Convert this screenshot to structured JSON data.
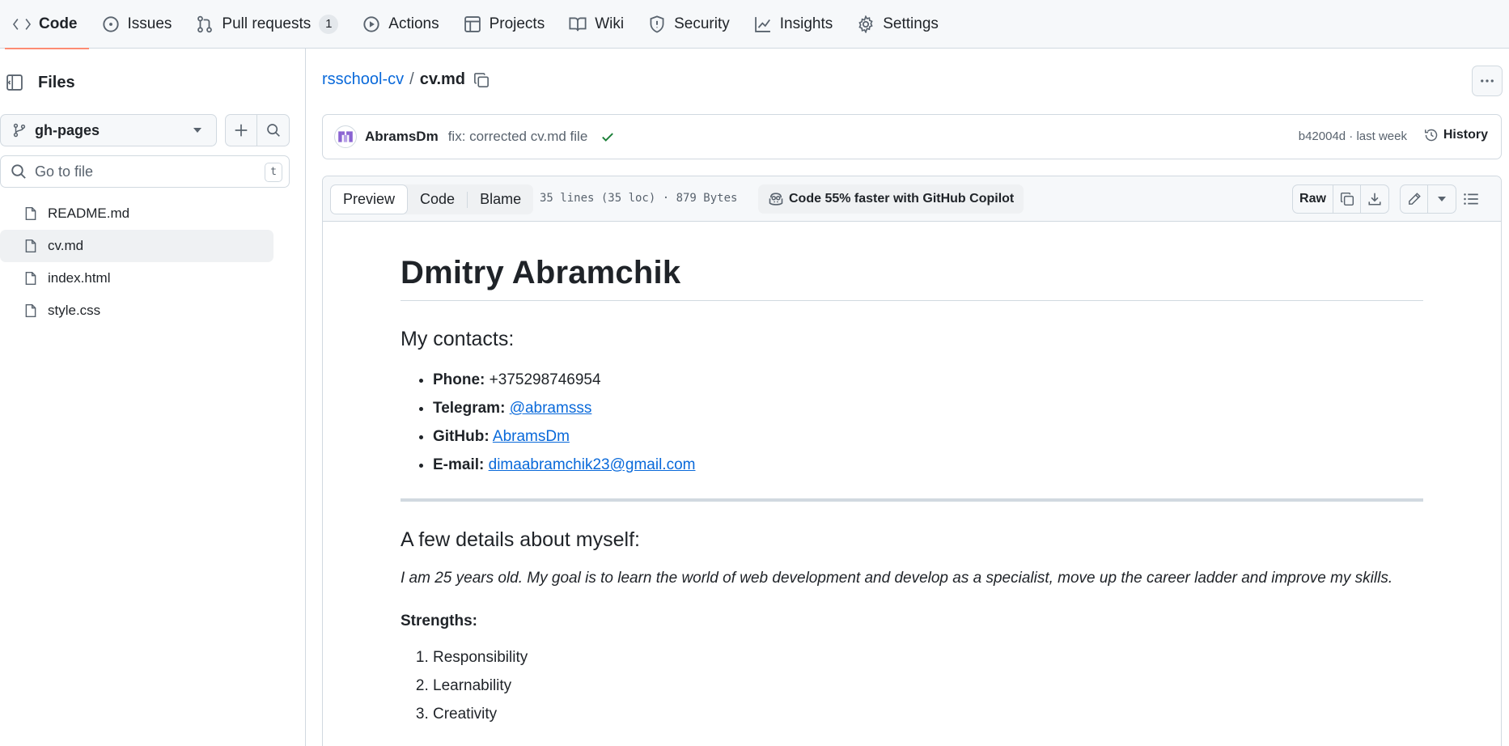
{
  "nav": {
    "tabs": [
      {
        "label": "Code",
        "icon": "code-icon"
      },
      {
        "label": "Issues",
        "icon": "issue-icon"
      },
      {
        "label": "Pull requests",
        "icon": "pull-request-icon",
        "count": "1"
      },
      {
        "label": "Actions",
        "icon": "play-icon"
      },
      {
        "label": "Projects",
        "icon": "table-icon"
      },
      {
        "label": "Wiki",
        "icon": "book-icon"
      },
      {
        "label": "Security",
        "icon": "shield-icon"
      },
      {
        "label": "Insights",
        "icon": "graph-icon"
      },
      {
        "label": "Settings",
        "icon": "gear-icon"
      }
    ],
    "active": "Code",
    "accent": "#fd8c73"
  },
  "sidebar": {
    "title": "Files",
    "branch": "gh-pages",
    "goto_placeholder": "Go to file",
    "goto_key": "t",
    "files": [
      {
        "name": "README.md",
        "active": false
      },
      {
        "name": "cv.md",
        "active": true
      },
      {
        "name": "index.html",
        "active": false
      },
      {
        "name": "style.css",
        "active": false
      }
    ]
  },
  "breadcrumb": {
    "repo": "rsschool-cv",
    "separator": "/",
    "file": "cv.md"
  },
  "commit": {
    "author": "AbramsDm",
    "message": "fix: corrected cv.md file",
    "meta": "b42004d · last week",
    "history_label": "History",
    "status_color": "#1a7f37"
  },
  "file_header": {
    "tabs": [
      "Preview",
      "Code",
      "Blame"
    ],
    "active_tab": "Preview",
    "loc": "35 lines (35 loc) · 879 Bytes",
    "copilot": "Code 55% faster with GitHub Copilot",
    "raw_label": "Raw"
  },
  "content": {
    "title": "Dmitry Abramchik",
    "contacts_heading": "My contacts:",
    "contacts": [
      {
        "label": "Phone:",
        "value": "+375298746954",
        "link": false
      },
      {
        "label": "Telegram:",
        "value": "@abramsss",
        "link": true
      },
      {
        "label": "GitHub:",
        "value": "AbramsDm",
        "link": true
      },
      {
        "label": "E-mail:",
        "value": "dimaabramchik23@gmail.com",
        "link": true
      }
    ],
    "about_heading": "A few details about myself:",
    "about_text": "I am 25 years old. My goal is to learn the world of web development and develop as a specialist, move up the career ladder and improve my skills.",
    "strengths_label": "Strengths:",
    "strengths": [
      "Responsibility",
      "Learnability",
      "Creativity"
    ]
  },
  "colors": {
    "link": "#0969da",
    "border": "#d1d9e0",
    "muted": "#59636e"
  }
}
